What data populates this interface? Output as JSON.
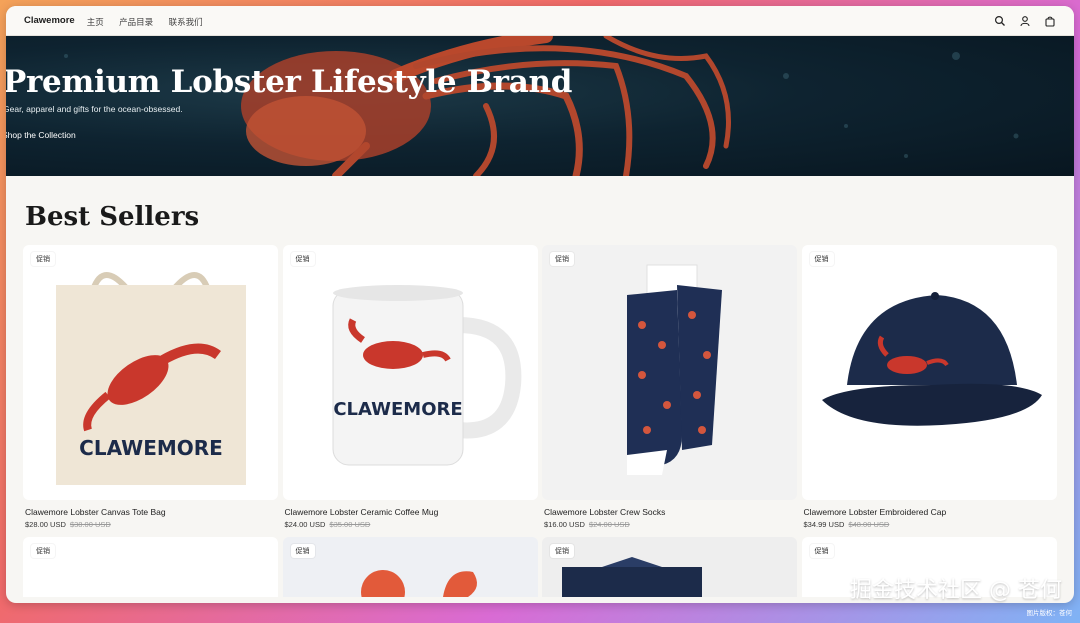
{
  "header": {
    "brand": "Clawemore",
    "nav": [
      "主页",
      "产品目录",
      "联系我们"
    ]
  },
  "hero": {
    "title": "Premium Lobster Lifestyle Brand",
    "subtitle": "Gear, apparel and gifts for the ocean-obsessed.",
    "cta": "Shop the Collection"
  },
  "section": {
    "title": "Best Sellers"
  },
  "products": [
    {
      "badge": "促销",
      "name": "Clawemore Lobster Canvas Tote Bag",
      "price": "$28.00 USD",
      "compare": "$38.00 USD",
      "image": "tote-bag"
    },
    {
      "badge": "促销",
      "name": "Clawemore Lobster Ceramic Coffee Mug",
      "price": "$24.00 USD",
      "compare": "$35.00 USD",
      "image": "coffee-mug"
    },
    {
      "badge": "促销",
      "name": "Clawemore Lobster Crew Socks",
      "price": "$16.00 USD",
      "compare": "$24.00 USD",
      "image": "crew-socks"
    },
    {
      "badge": "促销",
      "name": "Clawemore Lobster Embroidered Cap",
      "price": "$34.99 USD",
      "compare": "$48.00 USD",
      "image": "cap"
    }
  ],
  "products_row2": [
    {
      "badge": "促销"
    },
    {
      "badge": "促销"
    },
    {
      "badge": "促销"
    },
    {
      "badge": "促销"
    }
  ],
  "overlay": {
    "watermark": "掘金技术社区 @ 苍何",
    "credit": "图片版权：苍何"
  },
  "colors": {
    "lobster_red": "#c9372c",
    "navy": "#1c2b4a",
    "canvas": "#efe6d6"
  }
}
